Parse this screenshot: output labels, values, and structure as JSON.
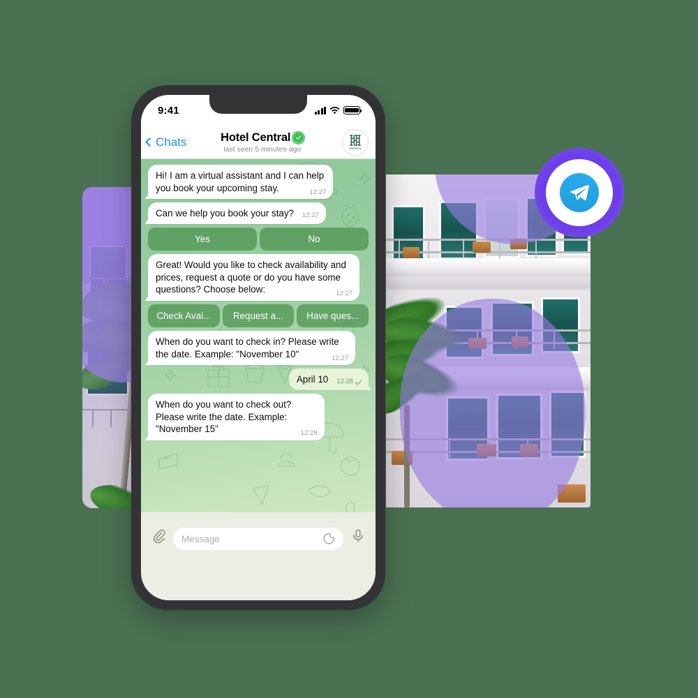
{
  "background": {
    "color": "#4a7152"
  },
  "phone": {
    "status_bar": {
      "time": "9:41",
      "signal_icon": "signal-bars-icon",
      "wifi_icon": "wifi-icon",
      "battery_icon": "battery-icon"
    },
    "header": {
      "back_label": "Chats",
      "title": "Hotel Central",
      "verified": true,
      "subtitle": "last seen 5 minutes ago",
      "avatar_caption": "HOTELS"
    },
    "messages": [
      {
        "id": "msg-intro",
        "direction": "in",
        "text": "Hi! I am a virtual assistant and I can help you book your upcoming stay.",
        "time": "12:27",
        "meta_inline": false
      },
      {
        "id": "msg-offer",
        "direction": "in",
        "text": "Can we help you book your stay?",
        "time": "12:27",
        "meta_inline": true
      },
      {
        "id": "msg-choose",
        "direction": "in",
        "text": "Great! Would you like to check availability and prices, request a quote or do you have some questions? Choose below:",
        "time": "12:27",
        "meta_inline": false
      },
      {
        "id": "msg-checkin",
        "direction": "in",
        "text": "When do you want to check in? Please write the date. Example: \"November 10\"",
        "time": "12:27",
        "meta_inline": false
      },
      {
        "id": "msg-april",
        "direction": "out",
        "text": "April 10",
        "time": "12:28",
        "meta_inline": true,
        "status_icon": "double-check-icon"
      },
      {
        "id": "msg-checkout",
        "direction": "in",
        "text": "When do you want to check out? Please write the date. Example: \"November 15\"",
        "time": "12:28",
        "meta_inline": false
      }
    ],
    "quick_replies": {
      "yes_no": [
        "Yes",
        "No"
      ],
      "options": [
        "Check Avai...",
        "Request a...",
        "Have ques..."
      ]
    },
    "input_bar": {
      "attach_icon": "paperclip-icon",
      "placeholder": "Message",
      "sticker_icon": "sticker-icon",
      "mic_icon": "microphone-icon"
    }
  },
  "telegram_badge": {
    "icon": "telegram-plane-icon",
    "ring_color": "#6c3fe8",
    "logo_color": "#229ed9"
  }
}
